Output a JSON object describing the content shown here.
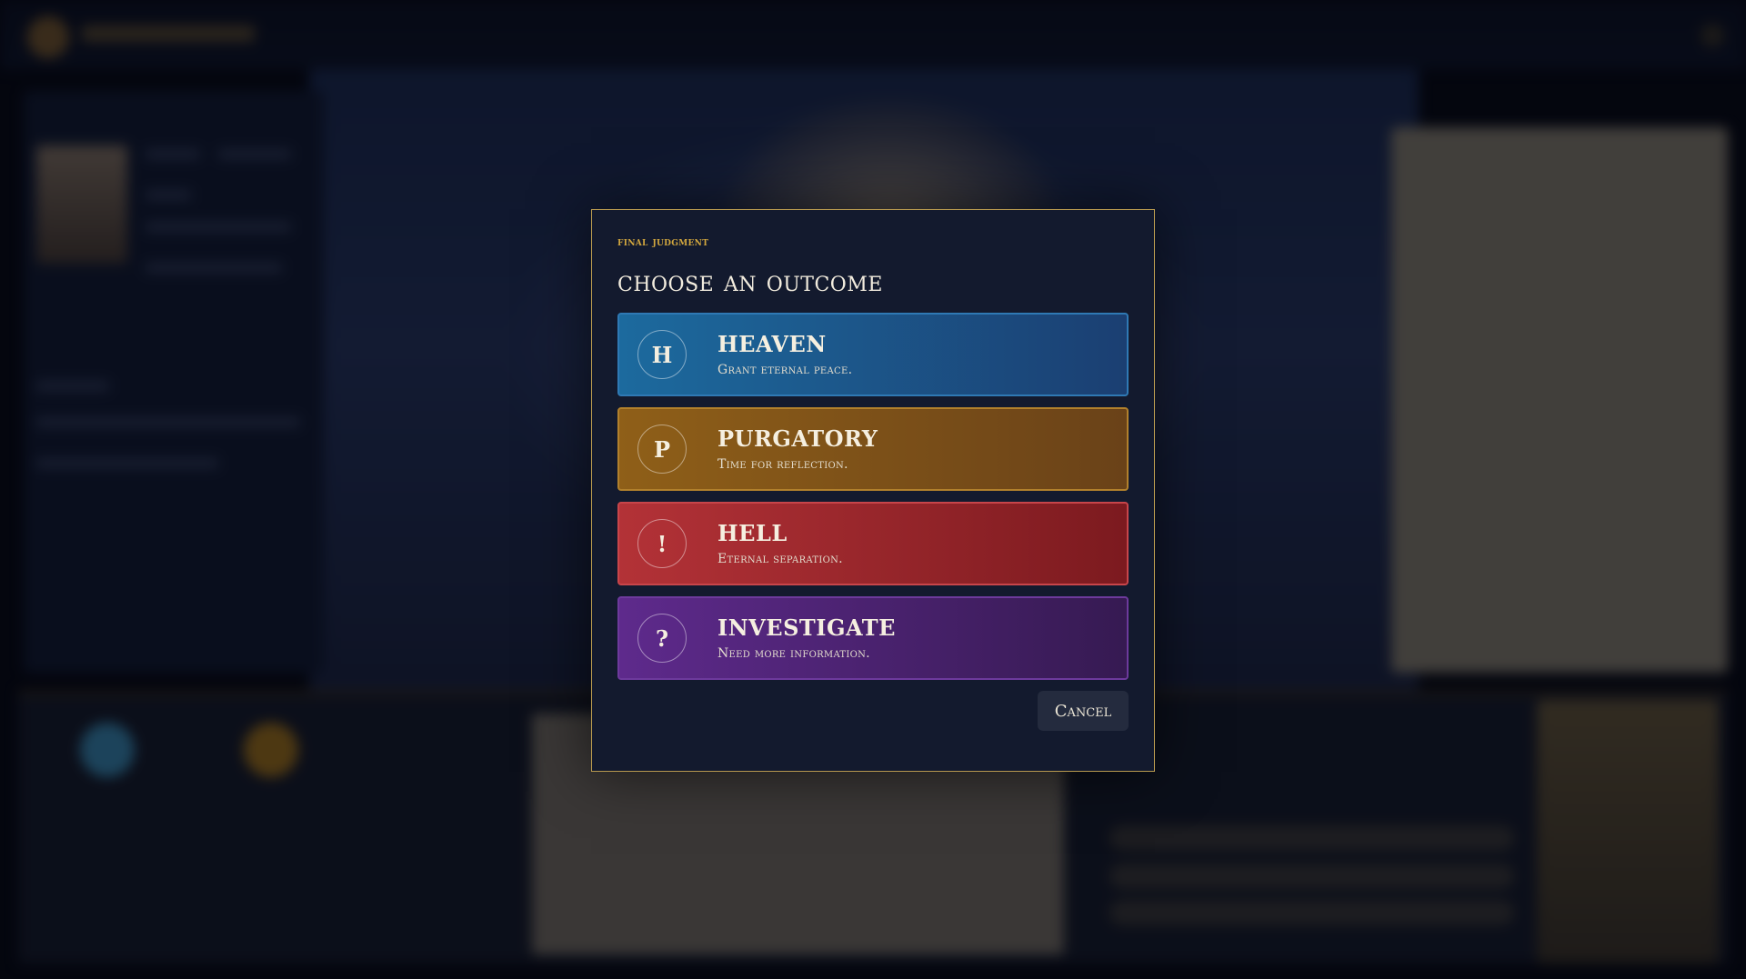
{
  "modal": {
    "eyebrow": "Final Judgment",
    "title": "Choose an Outcome",
    "options": [
      {
        "letter": "H",
        "title": "HEAVEN",
        "description": "Grant eternal peace."
      },
      {
        "letter": "P",
        "title": "PURGATORY",
        "description": "Time for reflection."
      },
      {
        "letter": "!",
        "title": "HELL",
        "description": "Eternal separation."
      },
      {
        "letter": "?",
        "title": "INVESTIGATE",
        "description": "Need more information."
      }
    ],
    "cancel_label": "Cancel"
  },
  "colors": {
    "accent_gold": "#d2a73e",
    "heaven": "#1c6a9e",
    "purgatory": "#8f5f18",
    "hell": "#b33237",
    "investigate": "#5e2a8c"
  }
}
